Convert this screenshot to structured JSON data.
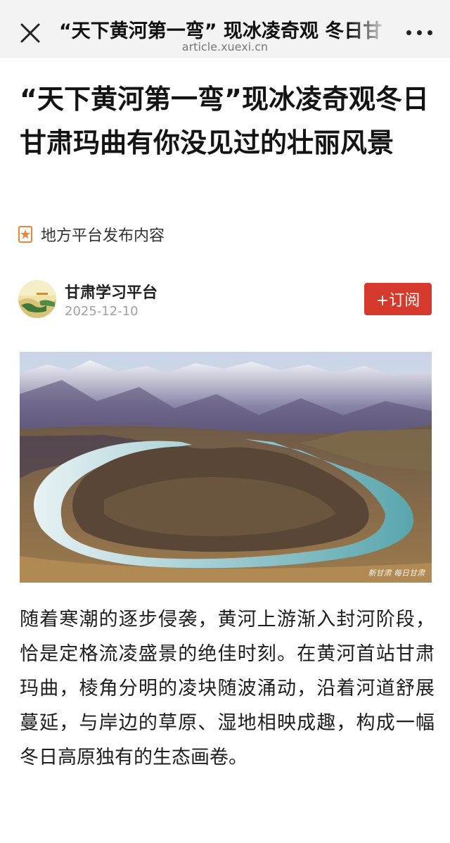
{
  "topbar": {
    "title": "“天下黄河第一弯” 现冰凌奇观 冬日甘",
    "url": "article.xuexi.cn",
    "close_icon": "close-icon",
    "more_icon": "more-dots-icon"
  },
  "article": {
    "title": "“天下黄河第一弯”现冰凌奇观冬日甘肃玛曲有你没见过的壮丽风景",
    "source_tag": "地方平台发布内容",
    "author": {
      "name": "甘肃学习平台",
      "date": "2025-12-10"
    },
    "subscribe_label": "+订阅",
    "image_watermark": "新甘肃 每日甘肃",
    "body": "随着寒潮的逐步侵袭，黄河上游渐入封河阶段，恰是定格流凌盛景的绝佳时刻。在黄河首站甘肃玛曲，棱角分明的凌块随波涌动，沿着河道舒展蔓延，与岸边的草原、湿地相映成趣，构成一幅冬日高原独有的生态画卷。"
  },
  "colors": {
    "accent": "#d63a2c",
    "topbar_bg": "#f3f3f3",
    "badge": "#e8893a"
  }
}
